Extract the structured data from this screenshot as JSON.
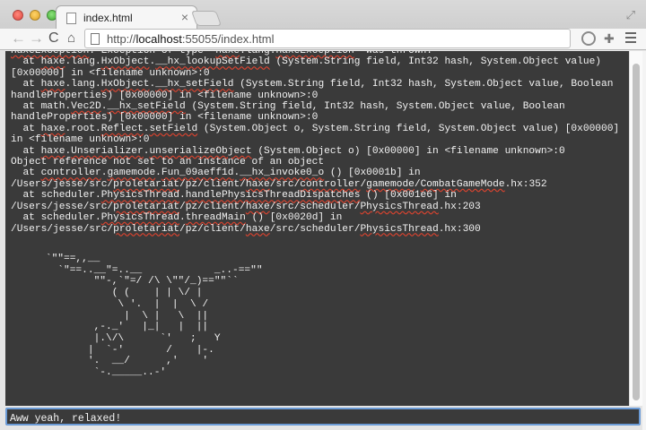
{
  "tab": {
    "title": "index.html",
    "close_glyph": "×"
  },
  "toolbar": {
    "back_glyph": "←",
    "forward_glyph": "→",
    "reload_glyph": "C",
    "home_glyph": "⌂",
    "url_prefix": "http://",
    "url_host": "localhost",
    "url_rest": ":55055/index.html",
    "extension_glyph": "✚"
  },
  "console": {
    "lines": [
      "HaxeException: Exception of type 'haxe.lang.HaxeException' was thrown.",
      "  at haxe.lang.HxObject.__hx_lookupSetField (System.String field, Int32 hash, System.Object value) [0x00000] in <filename unknown>:0",
      "  at haxe.lang.HxObject.__hx_setField (System.String field, Int32 hash, System.Object value, Boolean handleProperties) [0x00000] in <filename unknown>:0",
      "  at math.Vec2D.__hx_setField (System.String field, Int32 hash, System.Object value, Boolean handleProperties) [0x00000] in <filename unknown>:0",
      "  at haxe.root.Reflect.setField (System.Object o, System.String field, System.Object value) [0x00000] in <filename unknown>:0",
      "  at haxe.Unserializer.unserializeObject (System.Object o) [0x00000] in <filename unknown>:0",
      "Object reference not set to an instance of an object",
      "  at controller.gamemode.Fun_09aeff1d.__hx_invoke0_o () [0x0001b] in /Users/jesse/src/proletariat/pz/client/haxe/src/controller/gamemode/CombatGameMode.hx:352",
      "  at scheduler.PhysicsThread.handlePhysicsThreadDispatches () [0x001e6] in /Users/jesse/src/proletariat/pz/client/haxe/src/scheduler/PhysicsThread.hx:203",
      "  at scheduler.PhysicsThread.threadMain () [0x0020d] in /Users/jesse/src/proletariat/pz/client/haxe/src/scheduler/PhysicsThread.hx:300"
    ],
    "ascii_art": "    `\"\"==,,__\n      `\"==..__\"=..__            _..-==\"\"\n            \"\"-,`\"=/ /\\ \\\"\"/_)==\"\"``\n               ( (    | | \\/ |\n                \\ '.  |  |  \\ /\n                 |  \\ |   \\  ||\n            ,-._'   |_|   |  ||\n            |.\\/\\      `'   ;   Y\n           |  `-'       /    |-.\n           '.  __/      ,'    '\n            `-._____..-'",
    "input_value": "Aww yeah, relaxed!"
  }
}
